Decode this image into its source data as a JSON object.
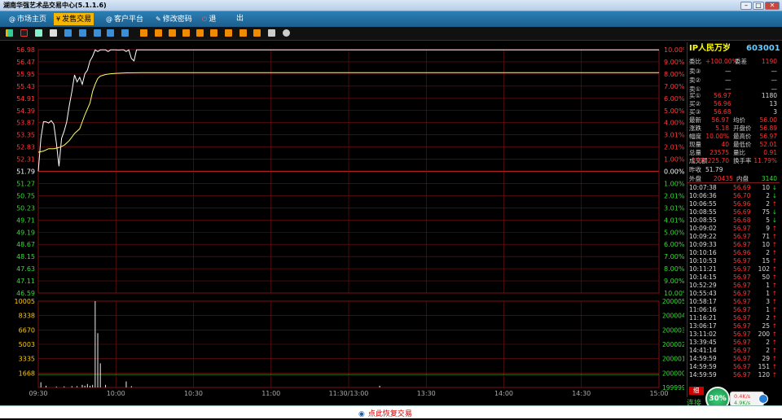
{
  "window": {
    "title": "湖南华强艺术品交易中心(5.1.1.6)"
  },
  "menu": [
    {
      "label": "市场主页",
      "icon": "@"
    },
    {
      "label": "发售交易",
      "icon": "¥"
    },
    {
      "label": "客户平台",
      "icon": "@"
    },
    {
      "label": "修改密码",
      "icon": "✎"
    },
    {
      "label": "退",
      "icon": "⏻"
    },
    {
      "label": "出",
      "icon": ""
    }
  ],
  "colors": {
    "up": "#ff3b3b",
    "down": "#33dd33",
    "grid": "#7a1010",
    "price_line": "#ffffff",
    "avg_line": "#ffff66",
    "accent": "#f4b400"
  },
  "stock": {
    "name": "IP人民万岁",
    "code": "603001"
  },
  "sidebar": {
    "weibi": {
      "label": "委比",
      "value": "+100.00%",
      "cha_label": "委差",
      "cha": "1190"
    },
    "sells": [
      {
        "label": "卖③",
        "price": "—",
        "vol": "—"
      },
      {
        "label": "卖②",
        "price": "—",
        "vol": "—"
      },
      {
        "label": "卖①",
        "price": "—",
        "vol": "—"
      }
    ],
    "buys": [
      {
        "label": "买①",
        "price": "56.97",
        "vol": "1180"
      },
      {
        "label": "买②",
        "price": "56.96",
        "vol": "13"
      },
      {
        "label": "买③",
        "price": "56.68",
        "vol": "3"
      }
    ],
    "stats": [
      {
        "l1": "最新",
        "v1": "56.97",
        "l2": "均价",
        "v2": "56.00"
      },
      {
        "l1": "涨跌",
        "v1": "5.18",
        "l2": "开盘价",
        "v2": "56.89"
      },
      {
        "l1": "幅度",
        "v1": "10.00%",
        "l2": "最高价",
        "v2": "56.97"
      },
      {
        "l1": "现量",
        "v1": "40",
        "l2": "最低价",
        "v2": "52.01"
      },
      {
        "l1": "总量",
        "v1": "23575",
        "l2": "量比",
        "v2": "0.91"
      },
      {
        "l1": "成交额",
        "v1": "1320225.70",
        "l2": "换手率",
        "v2": "11.79%"
      }
    ],
    "prev_close": {
      "label": "昨收",
      "value": "51.79"
    },
    "outer": {
      "label": "外盘",
      "value": "20435",
      "inner_label": "内盘",
      "inner_value": "3140"
    },
    "ticks": [
      [
        "10:07:38",
        "56.69",
        "10",
        "↓"
      ],
      [
        "10:06:36",
        "56.70",
        "2",
        "↓"
      ],
      [
        "10:06:55",
        "56.96",
        "2",
        "↑"
      ],
      [
        "10:08:55",
        "56.69",
        "75",
        "↓"
      ],
      [
        "10:08:55",
        "56.68",
        "5",
        "↓"
      ],
      [
        "10:09:02",
        "56.97",
        "9",
        "↑"
      ],
      [
        "10:09:22",
        "56.97",
        "71",
        "↑"
      ],
      [
        "10:09:33",
        "56.97",
        "10",
        "↑"
      ],
      [
        "10:10:16",
        "56.96",
        "2",
        "↑"
      ],
      [
        "10:10:53",
        "56.97",
        "15",
        "↑"
      ],
      [
        "10:11:21",
        "56.97",
        "102",
        "↑"
      ],
      [
        "10:14:15",
        "56.97",
        "50",
        "↑"
      ],
      [
        "10:52:29",
        "56.97",
        "1",
        "↑"
      ],
      [
        "10:55:43",
        "56.97",
        "1",
        "↑"
      ],
      [
        "10:58:17",
        "56.97",
        "3",
        "↑"
      ],
      [
        "11:06:16",
        "56.97",
        "1",
        "↑"
      ],
      [
        "11:16:21",
        "56.97",
        "2",
        "↑"
      ],
      [
        "13:06:17",
        "56.97",
        "25",
        "↑"
      ],
      [
        "13:11:02",
        "56.97",
        "200",
        "↑"
      ],
      [
        "13:39:45",
        "56.97",
        "2",
        "↑"
      ],
      [
        "14:41:14",
        "56.97",
        "2",
        "↑"
      ],
      [
        "14:59:59",
        "56.97",
        "29",
        "↑"
      ],
      [
        "14:59:59",
        "56.97",
        "151",
        "↑"
      ],
      [
        "14:59:59",
        "56.97",
        "120",
        "↑"
      ]
    ],
    "tab": "细",
    "connect": "连接"
  },
  "speed": {
    "percent": "30%",
    "up": "0.4K/s",
    "down": "4.9K/s"
  },
  "bottom": {
    "restore": "点此恢复交易"
  },
  "chart_data": {
    "type": "line",
    "price_ticks": [
      "56.98",
      "56.47",
      "55.95",
      "55.43",
      "54.91",
      "54.39",
      "53.87",
      "53.35",
      "52.83",
      "52.31",
      "51.79",
      "51.27",
      "50.75",
      "50.23",
      "49.71",
      "49.19",
      "48.67",
      "48.15",
      "47.63",
      "47.11",
      "46.59"
    ],
    "pct_ticks": [
      "10.00%",
      "9.00%",
      "8.00%",
      "7.00%",
      "6.00%",
      "5.00%",
      "4.00%",
      "3.01%",
      "2.01%",
      "1.00%",
      "0.00%",
      "1.00%",
      "2.01%",
      "3.01%",
      "4.01%",
      "5.00%",
      "6.00%",
      "7.00%",
      "8.00%",
      "9.00%",
      "10.00%"
    ],
    "price_range": [
      46.59,
      56.98
    ],
    "prev_close": 51.79,
    "vol_ticks": [
      "10005",
      "8338",
      "6670",
      "5003",
      "3335",
      "1668"
    ],
    "vol_right_ticks": [
      "200005",
      "200004",
      "200003",
      "200002",
      "200001",
      "200000",
      "199999"
    ],
    "vol_range": [
      0,
      10005
    ],
    "time_labels": [
      "09:30",
      "10:00",
      "10:30",
      "11:00",
      "11:30/13:00",
      "13:30",
      "14:00",
      "14:30",
      "15:00"
    ],
    "total_minutes": 240,
    "price": [
      [
        0,
        51.79
      ],
      [
        1,
        53.2
      ],
      [
        2,
        53.9
      ],
      [
        3,
        53.9
      ],
      [
        4,
        53.85
      ],
      [
        5,
        53.95
      ],
      [
        6,
        53.8
      ],
      [
        7,
        53.0
      ],
      [
        8,
        52.0
      ],
      [
        9,
        53.2
      ],
      [
        10,
        53.5
      ],
      [
        11,
        53.9
      ],
      [
        12,
        54.6
      ],
      [
        13,
        55.2
      ],
      [
        14,
        55.9
      ],
      [
        15,
        55.6
      ],
      [
        16,
        55.8
      ],
      [
        17,
        55.5
      ],
      [
        18,
        55.95
      ],
      [
        19,
        56.1
      ],
      [
        20,
        56.5
      ],
      [
        21,
        56.7
      ],
      [
        22,
        56.97
      ],
      [
        23,
        56.9
      ],
      [
        24,
        56.97
      ],
      [
        25,
        56.97
      ],
      [
        26,
        56.97
      ],
      [
        27,
        56.9
      ],
      [
        28,
        56.97
      ],
      [
        29,
        56.97
      ],
      [
        30,
        56.97
      ],
      [
        31,
        56.96
      ],
      [
        32,
        56.97
      ],
      [
        33,
        56.97
      ],
      [
        34,
        56.9
      ],
      [
        35,
        56.97
      ],
      [
        36,
        56.6
      ],
      [
        37,
        56.5
      ],
      [
        38,
        56.97
      ],
      [
        39,
        56.97
      ],
      [
        40,
        56.97
      ]
    ],
    "avg": [
      [
        0,
        52.6
      ],
      [
        2,
        52.65
      ],
      [
        4,
        52.75
      ],
      [
        6,
        52.75
      ],
      [
        8,
        52.8
      ],
      [
        10,
        52.9
      ],
      [
        12,
        53.1
      ],
      [
        14,
        53.4
      ],
      [
        16,
        53.6
      ],
      [
        18,
        54.2
      ],
      [
        20,
        54.7
      ],
      [
        21,
        55.2
      ],
      [
        22,
        55.5
      ],
      [
        23,
        55.75
      ],
      [
        24,
        55.85
      ],
      [
        26,
        55.92
      ],
      [
        28,
        55.95
      ],
      [
        30,
        55.97
      ],
      [
        34,
        55.99
      ],
      [
        40,
        56.0
      ]
    ],
    "volume": [
      [
        1,
        600
      ],
      [
        3,
        200
      ],
      [
        7,
        100
      ],
      [
        10,
        120
      ],
      [
        13,
        150
      ],
      [
        15,
        150
      ],
      [
        17,
        300
      ],
      [
        18,
        200
      ],
      [
        19,
        400
      ],
      [
        20,
        200
      ],
      [
        21,
        300
      ],
      [
        22,
        10005
      ],
      [
        23,
        6300
      ],
      [
        24,
        2800
      ],
      [
        26,
        300
      ],
      [
        34,
        700
      ],
      [
        36,
        150
      ],
      [
        132,
        200
      ]
    ]
  }
}
